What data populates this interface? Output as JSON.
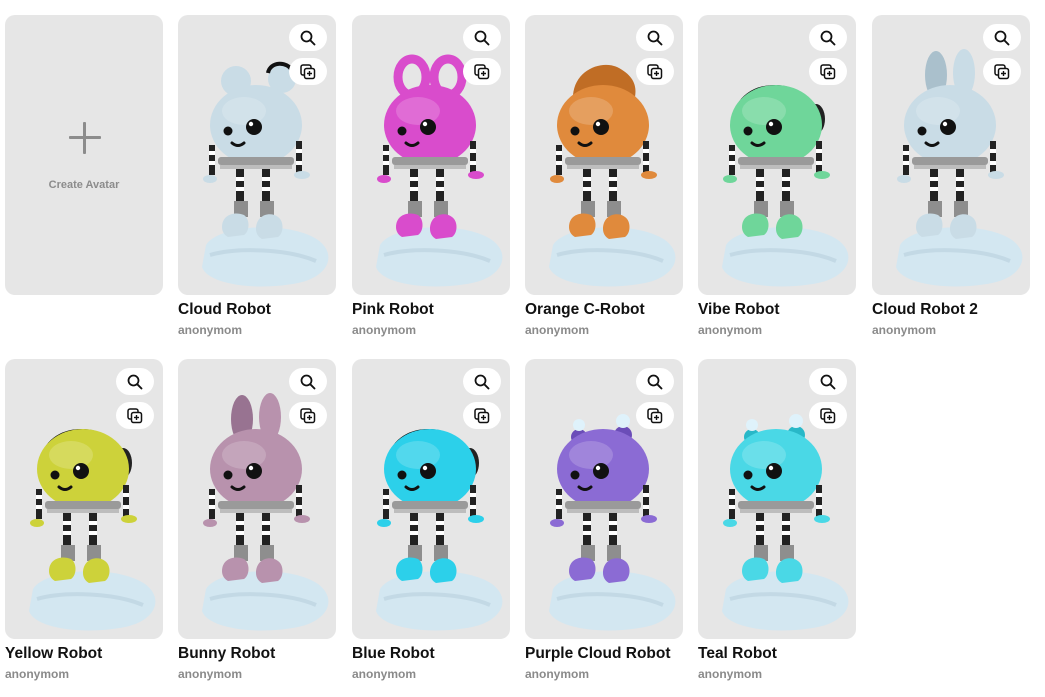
{
  "create": {
    "label": "Create Avatar"
  },
  "avatars": [
    {
      "name": "Cloud Robot",
      "author": "anonymom",
      "color": "#c9dce6",
      "shade": "#aac0cc",
      "ears": "cloud"
    },
    {
      "name": "Pink Robot",
      "author": "anonymom",
      "color": "#d94ccc",
      "shade": "#b033a6",
      "ears": "loops"
    },
    {
      "name": "Orange C-Robot",
      "author": "anonymom",
      "color": "#e08a3c",
      "shade": "#c06d25",
      "ears": "swirl"
    },
    {
      "name": "Vibe Robot",
      "author": "anonymom",
      "color": "#6fd69a",
      "shade": "#4fb87d",
      "ears": "headphones"
    },
    {
      "name": "Cloud Robot 2",
      "author": "anonymom",
      "color": "#c9dce6",
      "shade": "#aac0cc",
      "ears": "bunny"
    },
    {
      "name": "Yellow Robot",
      "author": "anonymom",
      "color": "#cdd23a",
      "shade": "#aab222",
      "ears": "headphones"
    },
    {
      "name": "Bunny Robot",
      "author": "anonymom",
      "color": "#b892ad",
      "shade": "#987391",
      "ears": "bunny"
    },
    {
      "name": "Blue Robot",
      "author": "anonymom",
      "color": "#2cd0ea",
      "shade": "#15aec8",
      "ears": "headphones"
    },
    {
      "name": "Purple Cloud Robot",
      "author": "anonymom",
      "color": "#8b6bd4",
      "shade": "#6b4db8",
      "ears": "puffs"
    },
    {
      "name": "Teal Robot",
      "author": "anonymom",
      "color": "#4ad8e6",
      "shade": "#28b8c8",
      "ears": "puffs"
    }
  ],
  "icons": {
    "zoom": "magnifier-icon",
    "copy": "duplicate-icon",
    "create": "plus-icon"
  }
}
